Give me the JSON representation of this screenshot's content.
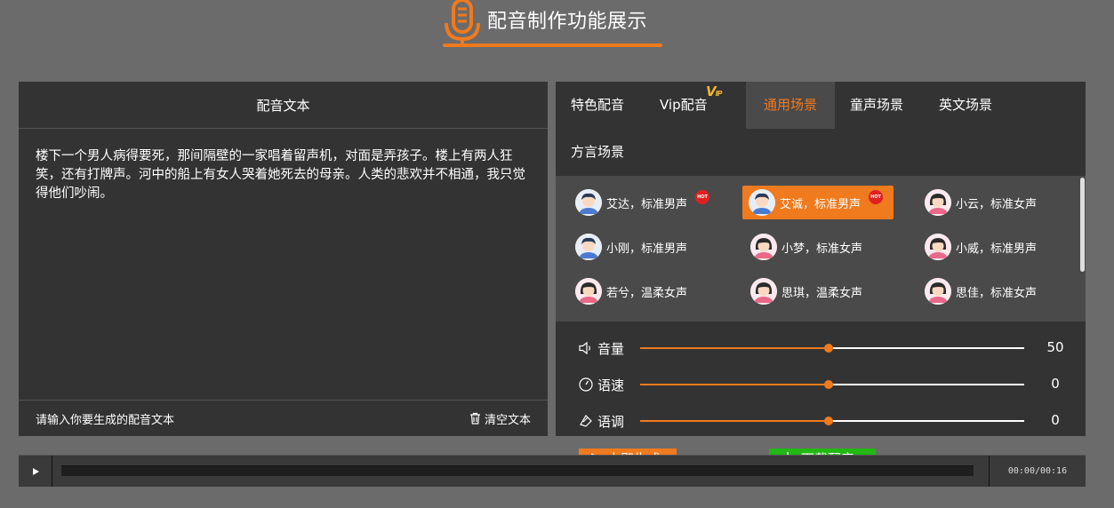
{
  "header": {
    "title": "配音制作功能展示"
  },
  "text_panel": {
    "title": "配音文本",
    "content": "楼下一个男人病得要死，那间隔壁的一家唱着留声机，对面是弄孩子。楼上有两人狂笑，还有打牌声。河中的船上有女人哭着她死去的母亲。人类的悲欢并不相通，我只觉得他们吵闹。",
    "placeholder_hint": "请输入你要生成的配音文本",
    "clear_label": "清空文本"
  },
  "tabs": [
    {
      "label": "特色配音",
      "active": false
    },
    {
      "label": "Vip配音",
      "active": false,
      "badge": "VIP"
    },
    {
      "label": "通用场景",
      "active": true
    },
    {
      "label": "童声场景",
      "active": false
    },
    {
      "label": "英文场景",
      "active": false
    },
    {
      "label": "方言场景",
      "active": false
    }
  ],
  "voices": [
    {
      "label": "艾达，标准男声",
      "gender": "male",
      "hot": true,
      "selected": false
    },
    {
      "label": "艾诚，标准男声",
      "gender": "male",
      "hot": true,
      "selected": true
    },
    {
      "label": "小云，标准女声",
      "gender": "female",
      "hot": false,
      "selected": false
    },
    {
      "label": "小刚，标准男声",
      "gender": "male",
      "hot": false,
      "selected": false
    },
    {
      "label": "小梦，标准女声",
      "gender": "female",
      "hot": false,
      "selected": false
    },
    {
      "label": "小威，标准男声",
      "gender": "male",
      "hot": false,
      "selected": false
    },
    {
      "label": "若兮，温柔女声",
      "gender": "female",
      "hot": false,
      "selected": false
    },
    {
      "label": "思琪，温柔女声",
      "gender": "female",
      "hot": false,
      "selected": false
    },
    {
      "label": "思佳，标准女声",
      "gender": "female",
      "hot": false,
      "selected": false
    }
  ],
  "hot_badge": "HOT",
  "sliders": [
    {
      "label": "音量",
      "value": "50",
      "percent": 49,
      "icon": "speaker-icon"
    },
    {
      "label": "语速",
      "value": "0",
      "percent": 49,
      "icon": "speedometer-icon"
    },
    {
      "label": "语调",
      "value": "0",
      "percent": 49,
      "icon": "tone-icon"
    }
  ],
  "actions": {
    "generate_label": "立即生成",
    "download_label": "下载配音"
  },
  "player": {
    "time": "00:00/00:16"
  },
  "colors": {
    "accent": "#f07a1e",
    "download": "#22b814",
    "panel": "#333333"
  }
}
